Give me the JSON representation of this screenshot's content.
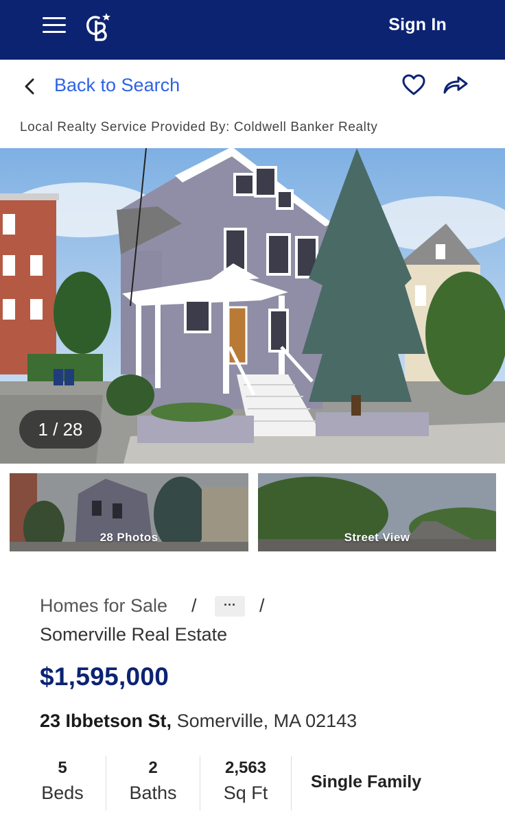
{
  "header": {
    "brand_colors": {
      "navy": "#0c2372",
      "link_blue": "#2d63e6"
    },
    "menu_icon": "hamburger-icon",
    "logo": "cb-logo",
    "sign_in_label": "Sign In"
  },
  "nav": {
    "back_label": "Back to Search",
    "favorite_icon": "heart-icon",
    "share_icon": "share-icon"
  },
  "service_text": "Local Realty Service Provided By: Coldwell Banker Realty",
  "gallery": {
    "counter": "1 / 28",
    "thumb_photos_label": "28 Photos",
    "thumb_street_label": "Street View"
  },
  "breadcrumb": {
    "level1": "Homes for Sale",
    "separator": "/",
    "more": "···",
    "level3": "Somerville Real Estate"
  },
  "listing": {
    "price": "$1,595,000",
    "street": "23 Ibbetson St,",
    "city_state_zip": "Somerville, MA 02143",
    "beds_value": "5",
    "beds_label": "Beds",
    "baths_value": "2",
    "baths_label": "Baths",
    "sqft_value": "2,563",
    "sqft_label": "Sq Ft",
    "property_type": "Single Family"
  }
}
